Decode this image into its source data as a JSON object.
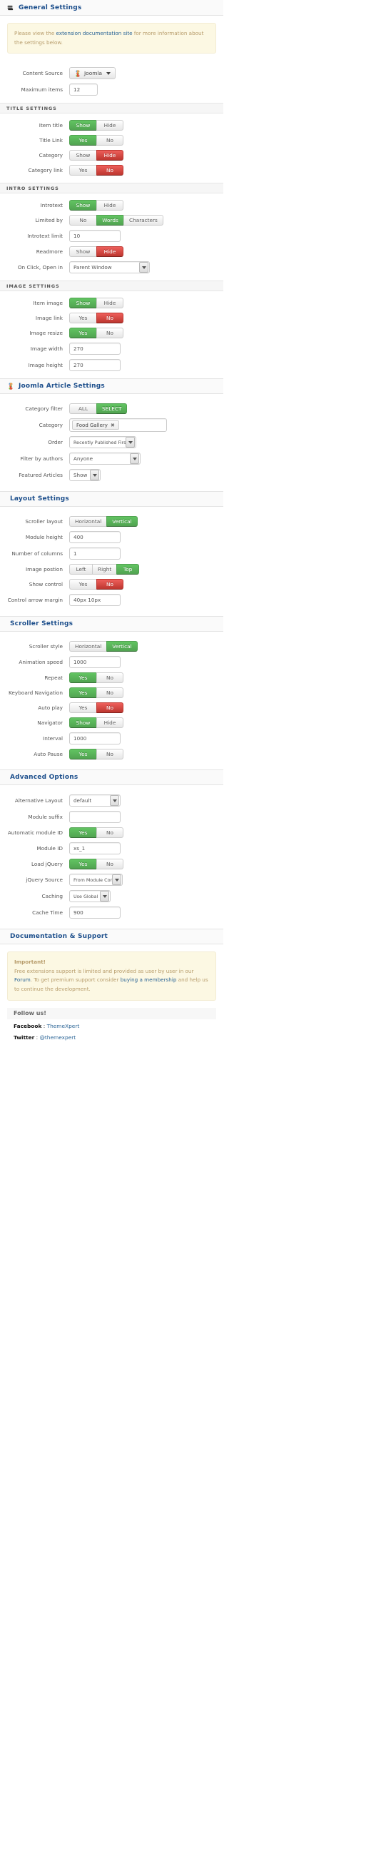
{
  "sections": {
    "general": {
      "title": "General Settings",
      "icon": "modules-icon",
      "alert": {
        "pre": "Please view the ",
        "link": "extension documentation site",
        "post": " for more information about the settings below."
      },
      "rows": [
        {
          "label": "Content Source",
          "type": "joomla-dropdown",
          "value": "Joomla"
        },
        {
          "label": "Maximum items",
          "type": "text",
          "value": "12"
        }
      ]
    },
    "title_settings": {
      "heading": "TITLE SETTINGS",
      "rows": [
        {
          "label": "Item title",
          "type": "toggle",
          "options": [
            "Show",
            "Hide"
          ],
          "selected": 0,
          "state": "green"
        },
        {
          "label": "Title Link",
          "type": "toggle",
          "options": [
            "Yes",
            "No"
          ],
          "selected": 0,
          "state": "green"
        },
        {
          "label": "Category",
          "type": "toggle",
          "options": [
            "Show",
            "Hide"
          ],
          "selected": 1,
          "state": "red"
        },
        {
          "label": "Category link",
          "type": "toggle",
          "options": [
            "Yes",
            "No"
          ],
          "selected": 1,
          "state": "red"
        }
      ]
    },
    "intro_settings": {
      "heading": "INTRO SETTINGS",
      "rows": [
        {
          "label": "Introtext",
          "type": "toggle",
          "options": [
            "Show",
            "Hide"
          ],
          "selected": 0,
          "state": "green"
        },
        {
          "label": "Limited by",
          "type": "toggle",
          "options": [
            "No",
            "Words",
            "Characters"
          ],
          "selected": 1,
          "state": "green"
        },
        {
          "label": "Introtext limit",
          "type": "text",
          "value": "10"
        },
        {
          "label": "Readmore",
          "type": "toggle",
          "options": [
            "Show",
            "Hide"
          ],
          "selected": 1,
          "state": "red"
        },
        {
          "label": "On Click, Open in",
          "type": "select",
          "value": "Parent Window"
        }
      ]
    },
    "image_settings": {
      "heading": "IMAGE SETTINGS",
      "rows": [
        {
          "label": "Item image",
          "type": "toggle",
          "options": [
            "Show",
            "Hide"
          ],
          "selected": 0,
          "state": "green"
        },
        {
          "label": "Image link",
          "type": "toggle",
          "options": [
            "Yes",
            "No"
          ],
          "selected": 1,
          "state": "red"
        },
        {
          "label": "Image resize",
          "type": "toggle",
          "options": [
            "Yes",
            "No"
          ],
          "selected": 0,
          "state": "green"
        },
        {
          "label": "Image width",
          "type": "text",
          "value": "270"
        },
        {
          "label": "Image height",
          "type": "text",
          "value": "270"
        }
      ]
    },
    "joomla_article": {
      "title": "Joomla Article Settings",
      "icon": "joomla-icon",
      "rows": [
        {
          "label": "Category filter",
          "type": "toggle",
          "options": [
            "ALL",
            "SELECT"
          ],
          "selected": 1,
          "state": "green"
        },
        {
          "label": "Category",
          "type": "chips",
          "chips": [
            "Food Gallery"
          ]
        },
        {
          "label": "Order",
          "type": "select",
          "value": "Recently Published First"
        },
        {
          "label": "Filter by authors",
          "type": "select-plain",
          "value": "Anyone"
        },
        {
          "label": "Featured Articles",
          "type": "select",
          "value": "Show"
        }
      ]
    },
    "layout": {
      "title": "Layout Settings",
      "rows": [
        {
          "label": "Scroller layout",
          "type": "toggle",
          "options": [
            "Horizontal",
            "Vertical"
          ],
          "selected": 1,
          "state": "green"
        },
        {
          "label": "Module height",
          "type": "text",
          "value": "400"
        },
        {
          "label": "Number of columns",
          "type": "text",
          "value": "1"
        },
        {
          "label": "Image postion",
          "type": "toggle",
          "options": [
            "Left",
            "Right",
            "Top"
          ],
          "selected": 2,
          "state": "green"
        },
        {
          "label": "Show control",
          "type": "toggle",
          "options": [
            "Yes",
            "No"
          ],
          "selected": 1,
          "state": "red"
        },
        {
          "label": "Control arrow margin",
          "type": "text",
          "value": "40px 10px"
        }
      ]
    },
    "scroller": {
      "title": "Scroller Settings",
      "rows": [
        {
          "label": "Scroller style",
          "type": "toggle",
          "options": [
            "Horizontal",
            "Vertical"
          ],
          "selected": 1,
          "state": "green"
        },
        {
          "label": "Animation speed",
          "type": "text",
          "value": "1000"
        },
        {
          "label": "Repeat",
          "type": "toggle",
          "options": [
            "Yes",
            "No"
          ],
          "selected": 0,
          "state": "green"
        },
        {
          "label": "Keyboard Navigation",
          "type": "toggle",
          "options": [
            "Yes",
            "No"
          ],
          "selected": 0,
          "state": "green"
        },
        {
          "label": "Auto play",
          "type": "toggle",
          "options": [
            "Yes",
            "No"
          ],
          "selected": 1,
          "state": "red"
        },
        {
          "label": "Navigator",
          "type": "toggle",
          "options": [
            "Show",
            "Hide"
          ],
          "selected": 0,
          "state": "green"
        },
        {
          "label": "Interval",
          "type": "text",
          "value": "1000"
        },
        {
          "label": "Auto Pause",
          "type": "toggle",
          "options": [
            "Yes",
            "No"
          ],
          "selected": 0,
          "state": "green"
        }
      ]
    },
    "advanced": {
      "title": "Advanced Options",
      "rows": [
        {
          "label": "Alternative Layout",
          "type": "select",
          "value": "default"
        },
        {
          "label": "Module suffix",
          "type": "text",
          "value": ""
        },
        {
          "label": "Automatic module ID",
          "type": "toggle",
          "options": [
            "Yes",
            "No"
          ],
          "selected": 0,
          "state": "green"
        },
        {
          "label": "Module ID",
          "type": "text",
          "value": "xs_1"
        },
        {
          "label": "Load jQuery",
          "type": "toggle",
          "options": [
            "Yes",
            "No"
          ],
          "selected": 0,
          "state": "green"
        },
        {
          "label": "jQuery Source",
          "type": "select",
          "value": "From Module Core"
        },
        {
          "label": "Caching",
          "type": "select",
          "value": "Use Global"
        },
        {
          "label": "Cache Time",
          "type": "text",
          "value": "900"
        }
      ]
    },
    "docs": {
      "title": "Documentation & Support",
      "alert": {
        "strong": "Important!",
        "l1_pre": "Free extensions support is limited and provided as user by user in our ",
        "l1_link": "Forum",
        "l1_post": ".",
        "l2_pre": "To get premium support consider ",
        "l2_link": "buying a membership",
        "l2_post": " and help us to continue the development."
      },
      "follow_title": "Follow us!",
      "social": [
        {
          "network": "Facebook",
          "sep": " : ",
          "handle": "ThemeXpert"
        },
        {
          "network": "Twitter",
          "sep": " : ",
          "handle": "@themexpert"
        }
      ]
    }
  },
  "colors": {
    "heading": "#1d4f8c",
    "green": "#51a351",
    "red": "#bd362f",
    "alert_bg": "#fcf8e3",
    "alert_text": "#b79c6b",
    "link": "#2a6496"
  }
}
